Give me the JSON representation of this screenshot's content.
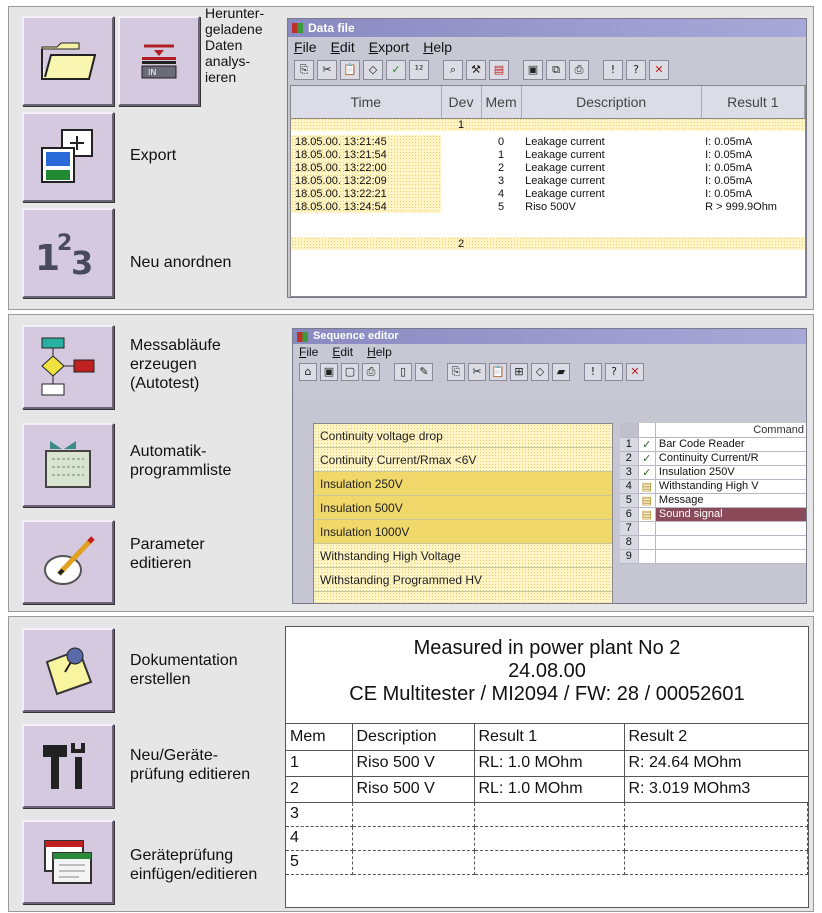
{
  "section1": {
    "labels": {
      "analyze": "Herunter-\ngeladene\nDaten\nanalys-\nieren",
      "export": "Export",
      "reorder": "Neu anordnen"
    },
    "window": {
      "title": "Data file",
      "menu": [
        "File",
        "Edit",
        "Export",
        "Help"
      ],
      "columns": [
        "Time",
        "Dev",
        "Mem",
        "Description",
        "Result 1"
      ],
      "group1": "1",
      "group2": "2",
      "rows": [
        {
          "time": "18.05.00. 13:21:45",
          "mem": "0",
          "desc": "Leakage current",
          "res": "I: 0.05mA"
        },
        {
          "time": "18.05.00. 13:21:54",
          "mem": "1",
          "desc": "Leakage current",
          "res": "I: 0.05mA"
        },
        {
          "time": "18.05.00. 13:22:00",
          "mem": "2",
          "desc": "Leakage current",
          "res": "I: 0.05mA"
        },
        {
          "time": "18.05.00. 13:22:09",
          "mem": "3",
          "desc": "Leakage current",
          "res": "I: 0.05mA"
        },
        {
          "time": "18.05.00. 13:22:21",
          "mem": "4",
          "desc": "Leakage current",
          "res": "I: 0.05mA"
        },
        {
          "time": "18.05.00. 13:24:54",
          "mem": "5",
          "desc": "Riso 500V",
          "res": "R > 999.9Ohm"
        }
      ]
    }
  },
  "section2": {
    "labels": {
      "sequences": "Messabläufe\nerzeugen\n(Autotest)",
      "autolist": "Automatik-\nprogrammliste",
      "params": "Parameter\neditieren"
    },
    "window": {
      "title": "Sequence editor",
      "menu": [
        "File",
        "Edit",
        "Help"
      ],
      "left_items": [
        "Continuity voltage drop",
        "Continuity Current/Rmax <6V",
        "Insulation 250V",
        "Insulation 500V",
        "Insulation 1000V",
        "Withstanding High Voltage",
        "Withstanding Programmed HV"
      ],
      "command_header": "Command",
      "commands": [
        {
          "n": "1",
          "icon": "check",
          "text": "Bar Code Reader"
        },
        {
          "n": "2",
          "icon": "check",
          "text": "Continuity Current/R"
        },
        {
          "n": "3",
          "icon": "check",
          "text": "Insulation 250V"
        },
        {
          "n": "4",
          "icon": "clipboard",
          "text": "Withstanding High V"
        },
        {
          "n": "5",
          "icon": "clipboard",
          "text": "Message"
        },
        {
          "n": "6",
          "icon": "clipboard",
          "text": "Sound signal"
        },
        {
          "n": "7",
          "icon": "",
          "text": ""
        },
        {
          "n": "8",
          "icon": "",
          "text": ""
        },
        {
          "n": "9",
          "icon": "",
          "text": ""
        }
      ]
    }
  },
  "section3": {
    "labels": {
      "doc": "Dokumentation\nerstellen",
      "edit": "Neu/Geräte-\nprüfung editieren",
      "insert": "Geräteprüfung\neinfügen/editieren"
    },
    "report": {
      "line1": "Measured in power plant No 2",
      "line2": "24.08.00",
      "line3": "CE Multitester / MI2094 / FW: 28 / 00052601",
      "headers": [
        "Mem",
        "Description",
        "Result 1",
        "Result 2"
      ],
      "rows": [
        [
          "1",
          "Riso 500 V",
          "RL: 1.0 MOhm",
          "R: 24.64 MOhm"
        ],
        [
          "2",
          "Riso 500 V",
          "RL: 1.0 MOhm",
          "R: 3.019 MOhm3"
        ],
        [
          "3",
          "",
          "",
          ""
        ],
        [
          "4",
          "",
          "",
          ""
        ],
        [
          "5",
          "",
          "",
          ""
        ]
      ]
    }
  },
  "colors": {
    "icon_button": "#d4c9df",
    "highlight_row": "#8a4a5a",
    "note_yellow": "#fff5c8"
  }
}
